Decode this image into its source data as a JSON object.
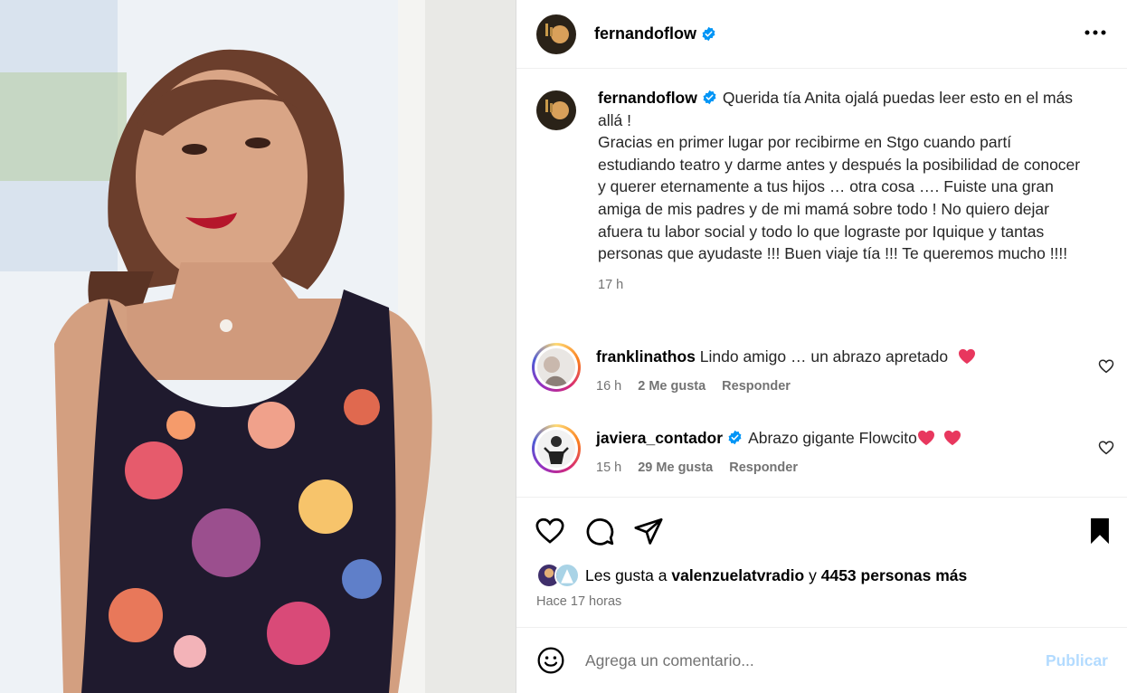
{
  "post": {
    "author": "fernandoflow",
    "caption_text": "Querida tía Anita ojalá puedas leer esto en el más allá !\nGracias en primer lugar por recibirme en Stgo cuando partí estudiando teatro y darme antes y después la posibilidad de conocer y querer eternamente a tus hijos … otra cosa …. Fuiste una gran amiga de mis padres y de mi mamá sobre todo ! No quiero dejar afuera tu labor social y todo lo que lograste por Iquique y tantas personas que ayudaste !!! Buen viaje tía !!! Te queremos mucho !!!!",
    "caption_time": "17 h"
  },
  "comments": [
    {
      "username": "franklinathos",
      "text": "Lindo amigo … un abrazo apretado",
      "time": "16 h",
      "likes": "2 Me gusta",
      "reply": "Responder",
      "verified": false
    },
    {
      "username": "javiera_contador",
      "text": "Abrazo gigante Flowcito",
      "time": "15 h",
      "likes": "29 Me gusta",
      "reply": "Responder",
      "verified": true
    }
  ],
  "likes": {
    "prefix": "Les gusta a",
    "user": "valenzuelatvradio",
    "connector": "y",
    "others": "4453 personas más"
  },
  "posted_ago": "Hace 17 horas",
  "comment_box": {
    "placeholder": "Agrega un comentario...",
    "publish_label": "Publicar"
  },
  "icons": {
    "verified": "verified-badge-icon",
    "more": "more-options-icon",
    "like": "heart-icon",
    "comment": "comment-icon",
    "share": "share-icon",
    "save": "bookmark-filled-icon",
    "emoji": "emoji-icon"
  },
  "colors": {
    "verified": "#0095f6",
    "publish_disabled": "#b3dbff",
    "muted_text": "#737373",
    "heart_emoji": "#e8375e"
  }
}
